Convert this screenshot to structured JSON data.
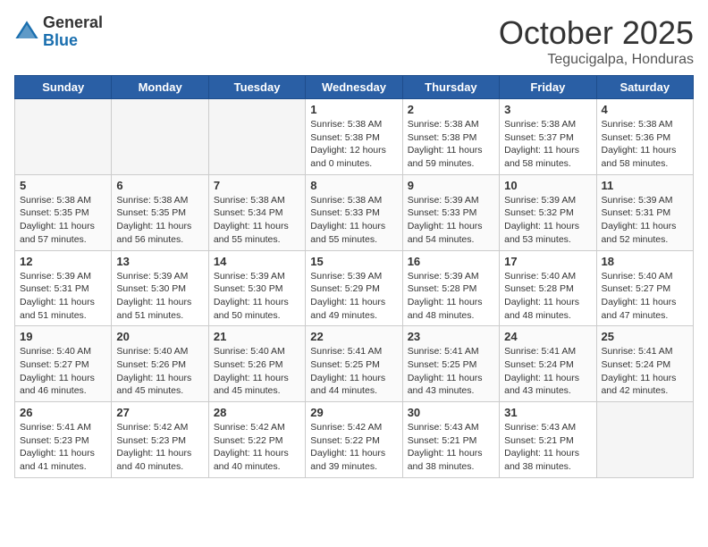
{
  "logo": {
    "general": "General",
    "blue": "Blue"
  },
  "header": {
    "month": "October 2025",
    "location": "Tegucigalpa, Honduras"
  },
  "weekdays": [
    "Sunday",
    "Monday",
    "Tuesday",
    "Wednesday",
    "Thursday",
    "Friday",
    "Saturday"
  ],
  "weeks": [
    [
      {
        "day": "",
        "info": ""
      },
      {
        "day": "",
        "info": ""
      },
      {
        "day": "",
        "info": ""
      },
      {
        "day": "1",
        "info": "Sunrise: 5:38 AM\nSunset: 5:38 PM\nDaylight: 12 hours\nand 0 minutes."
      },
      {
        "day": "2",
        "info": "Sunrise: 5:38 AM\nSunset: 5:38 PM\nDaylight: 11 hours\nand 59 minutes."
      },
      {
        "day": "3",
        "info": "Sunrise: 5:38 AM\nSunset: 5:37 PM\nDaylight: 11 hours\nand 58 minutes."
      },
      {
        "day": "4",
        "info": "Sunrise: 5:38 AM\nSunset: 5:36 PM\nDaylight: 11 hours\nand 58 minutes."
      }
    ],
    [
      {
        "day": "5",
        "info": "Sunrise: 5:38 AM\nSunset: 5:35 PM\nDaylight: 11 hours\nand 57 minutes."
      },
      {
        "day": "6",
        "info": "Sunrise: 5:38 AM\nSunset: 5:35 PM\nDaylight: 11 hours\nand 56 minutes."
      },
      {
        "day": "7",
        "info": "Sunrise: 5:38 AM\nSunset: 5:34 PM\nDaylight: 11 hours\nand 55 minutes."
      },
      {
        "day": "8",
        "info": "Sunrise: 5:38 AM\nSunset: 5:33 PM\nDaylight: 11 hours\nand 55 minutes."
      },
      {
        "day": "9",
        "info": "Sunrise: 5:39 AM\nSunset: 5:33 PM\nDaylight: 11 hours\nand 54 minutes."
      },
      {
        "day": "10",
        "info": "Sunrise: 5:39 AM\nSunset: 5:32 PM\nDaylight: 11 hours\nand 53 minutes."
      },
      {
        "day": "11",
        "info": "Sunrise: 5:39 AM\nSunset: 5:31 PM\nDaylight: 11 hours\nand 52 minutes."
      }
    ],
    [
      {
        "day": "12",
        "info": "Sunrise: 5:39 AM\nSunset: 5:31 PM\nDaylight: 11 hours\nand 51 minutes."
      },
      {
        "day": "13",
        "info": "Sunrise: 5:39 AM\nSunset: 5:30 PM\nDaylight: 11 hours\nand 51 minutes."
      },
      {
        "day": "14",
        "info": "Sunrise: 5:39 AM\nSunset: 5:30 PM\nDaylight: 11 hours\nand 50 minutes."
      },
      {
        "day": "15",
        "info": "Sunrise: 5:39 AM\nSunset: 5:29 PM\nDaylight: 11 hours\nand 49 minutes."
      },
      {
        "day": "16",
        "info": "Sunrise: 5:39 AM\nSunset: 5:28 PM\nDaylight: 11 hours\nand 48 minutes."
      },
      {
        "day": "17",
        "info": "Sunrise: 5:40 AM\nSunset: 5:28 PM\nDaylight: 11 hours\nand 48 minutes."
      },
      {
        "day": "18",
        "info": "Sunrise: 5:40 AM\nSunset: 5:27 PM\nDaylight: 11 hours\nand 47 minutes."
      }
    ],
    [
      {
        "day": "19",
        "info": "Sunrise: 5:40 AM\nSunset: 5:27 PM\nDaylight: 11 hours\nand 46 minutes."
      },
      {
        "day": "20",
        "info": "Sunrise: 5:40 AM\nSunset: 5:26 PM\nDaylight: 11 hours\nand 45 minutes."
      },
      {
        "day": "21",
        "info": "Sunrise: 5:40 AM\nSunset: 5:26 PM\nDaylight: 11 hours\nand 45 minutes."
      },
      {
        "day": "22",
        "info": "Sunrise: 5:41 AM\nSunset: 5:25 PM\nDaylight: 11 hours\nand 44 minutes."
      },
      {
        "day": "23",
        "info": "Sunrise: 5:41 AM\nSunset: 5:25 PM\nDaylight: 11 hours\nand 43 minutes."
      },
      {
        "day": "24",
        "info": "Sunrise: 5:41 AM\nSunset: 5:24 PM\nDaylight: 11 hours\nand 43 minutes."
      },
      {
        "day": "25",
        "info": "Sunrise: 5:41 AM\nSunset: 5:24 PM\nDaylight: 11 hours\nand 42 minutes."
      }
    ],
    [
      {
        "day": "26",
        "info": "Sunrise: 5:41 AM\nSunset: 5:23 PM\nDaylight: 11 hours\nand 41 minutes."
      },
      {
        "day": "27",
        "info": "Sunrise: 5:42 AM\nSunset: 5:23 PM\nDaylight: 11 hours\nand 40 minutes."
      },
      {
        "day": "28",
        "info": "Sunrise: 5:42 AM\nSunset: 5:22 PM\nDaylight: 11 hours\nand 40 minutes."
      },
      {
        "day": "29",
        "info": "Sunrise: 5:42 AM\nSunset: 5:22 PM\nDaylight: 11 hours\nand 39 minutes."
      },
      {
        "day": "30",
        "info": "Sunrise: 5:43 AM\nSunset: 5:21 PM\nDaylight: 11 hours\nand 38 minutes."
      },
      {
        "day": "31",
        "info": "Sunrise: 5:43 AM\nSunset: 5:21 PM\nDaylight: 11 hours\nand 38 minutes."
      },
      {
        "day": "",
        "info": ""
      }
    ]
  ]
}
